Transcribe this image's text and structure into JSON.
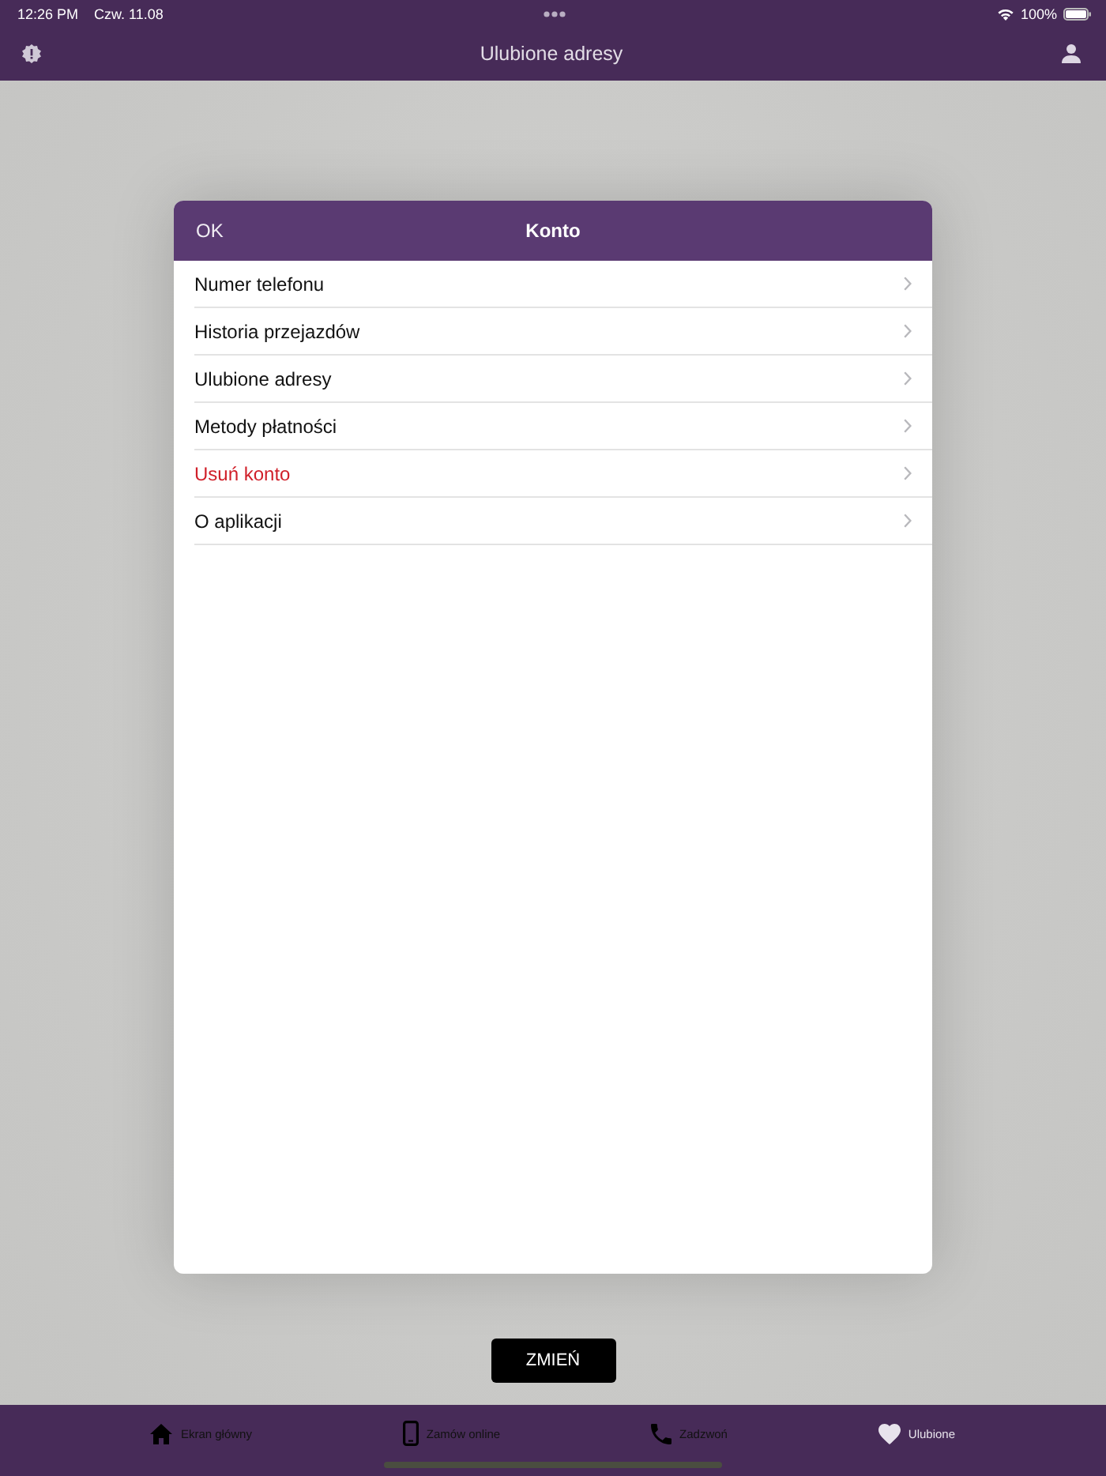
{
  "status_bar": {
    "time": "12:26 PM",
    "date": "Czw. 11.08",
    "battery": "100%"
  },
  "nav_bar": {
    "title": "Ulubione adresy"
  },
  "modal": {
    "close_button": "OK",
    "title": "Konto",
    "items": [
      {
        "label": "Numer telefonu",
        "kind": "normal"
      },
      {
        "label": "Historia przejazdów",
        "kind": "normal"
      },
      {
        "label": "Ulubione adresy",
        "kind": "normal"
      },
      {
        "label": "Metody płatności",
        "kind": "normal"
      },
      {
        "label": "Usuń konto",
        "kind": "destructive"
      },
      {
        "label": "O aplikacji",
        "kind": "normal"
      }
    ]
  },
  "action_button": "ZMIEŃ",
  "tab_bar": [
    {
      "label": "Ekran główny",
      "kind": "home",
      "selected": false
    },
    {
      "label": "Zamów online",
      "kind": "phone",
      "selected": false
    },
    {
      "label": "Zadzwoń",
      "kind": "call",
      "selected": false
    },
    {
      "label": "Ulubione",
      "kind": "heart",
      "selected": true
    }
  ]
}
